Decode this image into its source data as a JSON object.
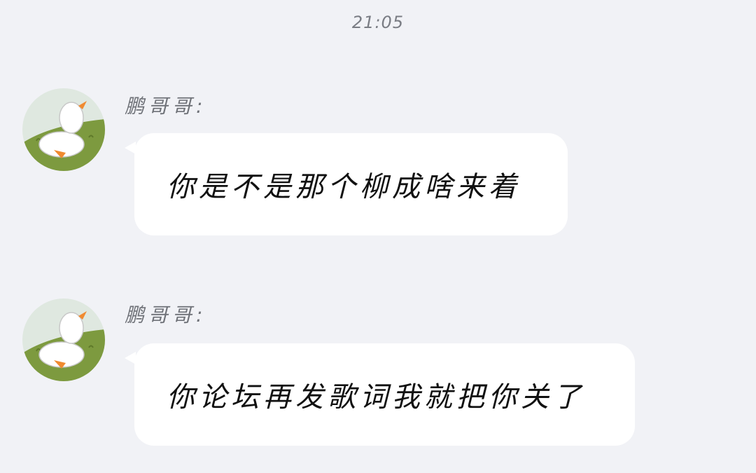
{
  "header": {
    "time": "21:05"
  },
  "messages": [
    {
      "sender": "鹏哥哥:",
      "avatar_icon": "duck-avatar-icon",
      "text": "你是不是那个柳成啥来着"
    },
    {
      "sender": "鹏哥哥:",
      "avatar_icon": "duck-avatar-icon",
      "text": "你论坛再发歌词我就把你关了"
    }
  ],
  "colors": {
    "background": "#f1f2f6",
    "bubble": "#ffffff",
    "avatar_grass": "#7d9a3f",
    "duck_beak": "#f08a30"
  }
}
